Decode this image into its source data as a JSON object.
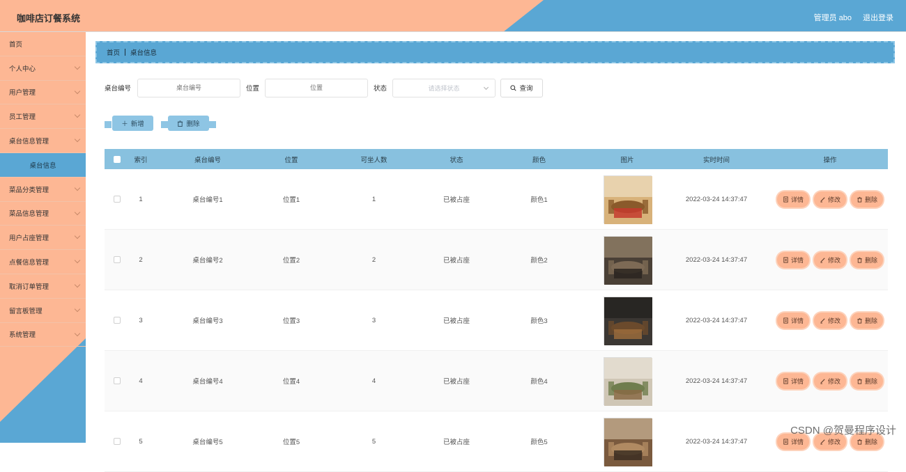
{
  "app": {
    "title": "咖啡店订餐系统"
  },
  "header": {
    "admin": "管理员 abo",
    "logout": "退出登录"
  },
  "sidebar": {
    "items": [
      {
        "label": "首页",
        "chevron": false
      },
      {
        "label": "个人中心",
        "chevron": true
      },
      {
        "label": "用户管理",
        "chevron": true
      },
      {
        "label": "员工管理",
        "chevron": true
      },
      {
        "label": "桌台信息管理",
        "chevron": true
      },
      {
        "label": "桌台信息",
        "sub": true
      },
      {
        "label": "菜品分类管理",
        "chevron": true
      },
      {
        "label": "菜品信息管理",
        "chevron": true
      },
      {
        "label": "用户占座管理",
        "chevron": true
      },
      {
        "label": "点餐信息管理",
        "chevron": true
      },
      {
        "label": "取消订单管理",
        "chevron": true
      },
      {
        "label": "留言板管理",
        "chevron": true
      },
      {
        "label": "系统管理",
        "chevron": true
      }
    ]
  },
  "breadcrumb": {
    "home": "首页",
    "current": "桌台信息"
  },
  "search": {
    "table_no_label": "桌台编号",
    "table_no_placeholder": "桌台编号",
    "position_label": "位置",
    "position_placeholder": "位置",
    "status_label": "状态",
    "status_placeholder": "请选择状态",
    "query_button": "查询"
  },
  "actions": {
    "add": "新增",
    "delete": "删除"
  },
  "table": {
    "columns": [
      "索引",
      "桌台编号",
      "位置",
      "可坐人数",
      "状态",
      "颜色",
      "图片",
      "实时时间",
      "操作"
    ],
    "rows": [
      {
        "index": "1",
        "table_no": "桌台编号1",
        "position": "位置1",
        "seats": "1",
        "status": "已被占座",
        "color": "颜色1",
        "time": "2022-03-24 14:37:47"
      },
      {
        "index": "2",
        "table_no": "桌台编号2",
        "position": "位置2",
        "seats": "2",
        "status": "已被占座",
        "color": "颜色2",
        "time": "2022-03-24 14:37:47"
      },
      {
        "index": "3",
        "table_no": "桌台编号3",
        "position": "位置3",
        "seats": "3",
        "status": "已被占座",
        "color": "颜色3",
        "time": "2022-03-24 14:37:47"
      },
      {
        "index": "4",
        "table_no": "桌台编号4",
        "position": "位置4",
        "seats": "4",
        "status": "已被占座",
        "color": "颜色4",
        "time": "2022-03-24 14:37:47"
      },
      {
        "index": "5",
        "table_no": "桌台编号5",
        "position": "位置5",
        "seats": "5",
        "status": "已被占座",
        "color": "颜色5",
        "time": "2022-03-24 14:37:47"
      }
    ],
    "ops": {
      "detail": "详情",
      "edit": "修改",
      "delete": "删除"
    }
  },
  "watermark": "CSDN @贺曼程序设计",
  "colors": {
    "peach": "#fdb794",
    "blue": "#5aa7d4",
    "header_row": "#88c1df"
  }
}
